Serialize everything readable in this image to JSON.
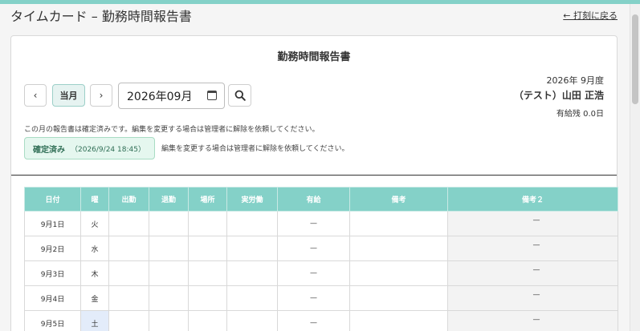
{
  "header": {
    "title": "タイムカード – 勤務時間報告書",
    "back_link": "← 打刻に戻る"
  },
  "report": {
    "title": "勤務時間報告書",
    "nav": {
      "prev": "‹",
      "current": "当月",
      "next": "›"
    },
    "month_value": "2026年09月",
    "period": "2026年 9月度",
    "user_name": "（テスト）山田 正浩",
    "leave_balance": "有給残 0.0日",
    "notice": "この月の報告書は確定済みです。編集を変更する場合は管理者に解除を依頼してください。",
    "status_badge": {
      "label": "確定済み",
      "timestamp": "（2026/9/24 18:45）"
    },
    "notice_inline": "編集を変更する場合は管理者に解除を依頼してください。"
  },
  "table": {
    "headers": [
      "日付",
      "曜",
      "出勤",
      "退勤",
      "場所",
      "実労働",
      "有給",
      "備考",
      "備考２"
    ],
    "rows": [
      {
        "date": "9月1日",
        "weekday": "火",
        "paid": "—",
        "memo2": "—"
      },
      {
        "date": "9月2日",
        "weekday": "水",
        "paid": "—",
        "memo2": "—"
      },
      {
        "date": "9月3日",
        "weekday": "木",
        "paid": "—",
        "memo2": "—"
      },
      {
        "date": "9月4日",
        "weekday": "金",
        "paid": "—",
        "memo2": "—"
      },
      {
        "date": "9月5日",
        "weekday": "土",
        "paid": "—",
        "memo2": "—"
      }
    ]
  },
  "colors": {
    "accent": "#84d1c8",
    "confirmed_badge": "#e5f7ef",
    "saturday": "#e3ecfa"
  },
  "icons": {
    "search": "search-icon",
    "calendar": "calendar-icon"
  }
}
